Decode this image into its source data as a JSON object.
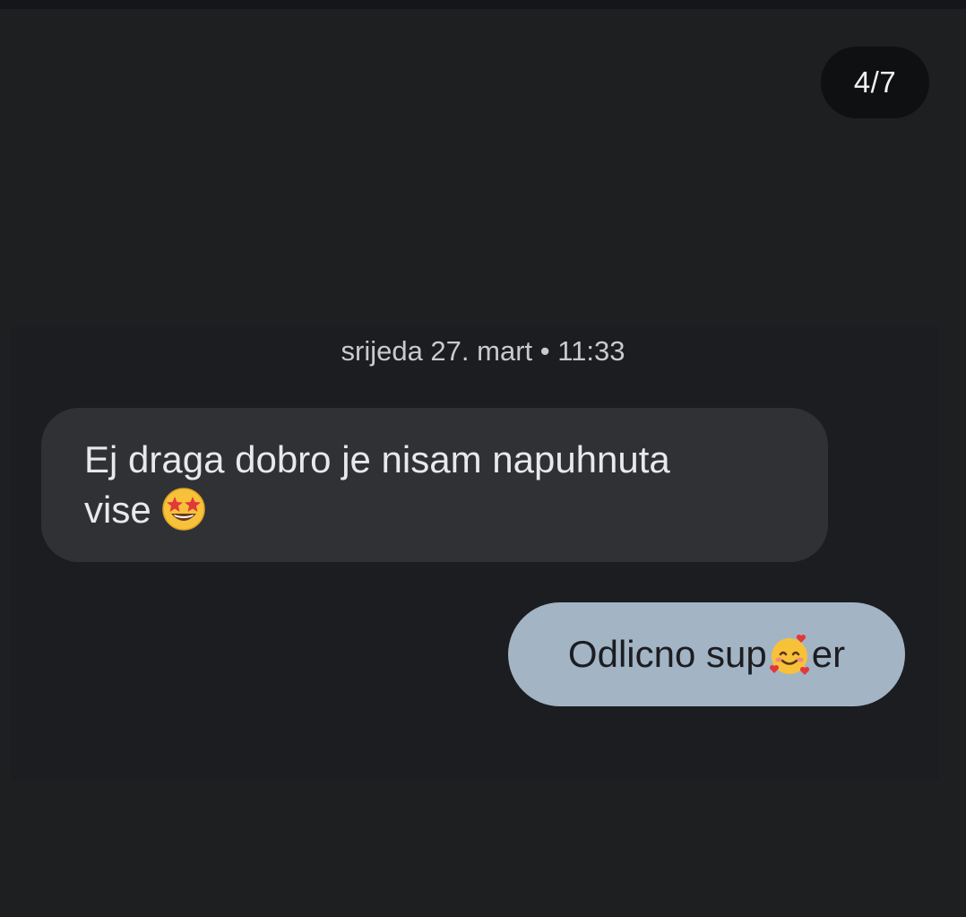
{
  "viewer": {
    "counter": "4/7"
  },
  "conversation": {
    "timestamp": "srijeda 27. mart • 11:33",
    "messages": [
      {
        "direction": "incoming",
        "text_line1": "Ej draga dobro je nisam napuhnuta",
        "text_line2": "vise",
        "emoji": "star-struck-emoji"
      },
      {
        "direction": "outgoing",
        "text_before": "Odlicno sup",
        "text_after": "er",
        "emoji": "smiling-face-with-hearts-emoji"
      }
    ]
  },
  "colors": {
    "background": "#1e1f21",
    "incoming_bubble": "#2f3135",
    "outgoing_bubble": "#a3b4c4",
    "counter_pill": "#0f1012"
  }
}
